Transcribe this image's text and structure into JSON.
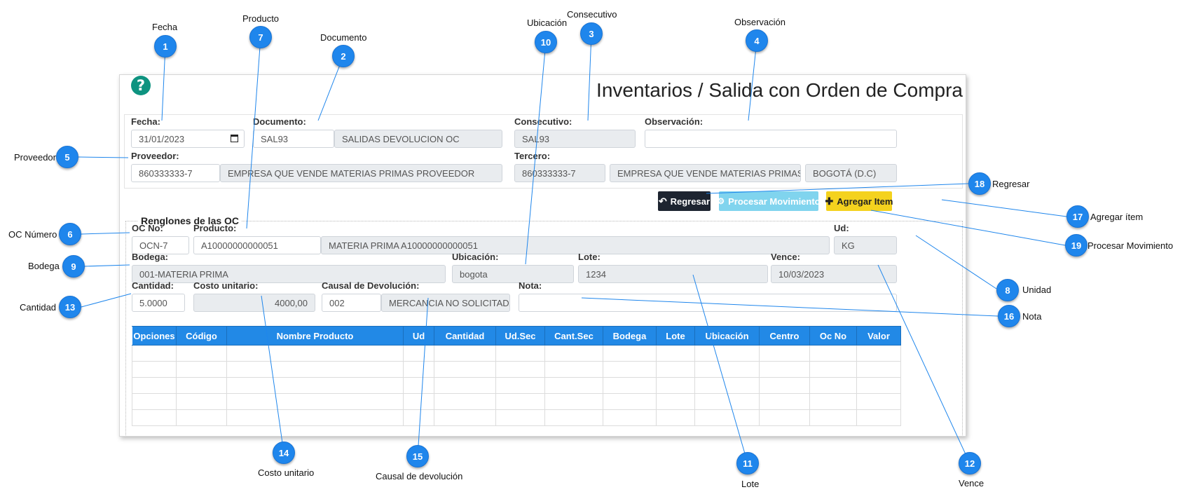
{
  "form": {
    "title": "Inventarios / Salida con Orden de Compra",
    "fecha_label": "Fecha:",
    "fecha_value": "31/01/2023",
    "documento_label": "Documento:",
    "documento_code": "SAL93",
    "documento_name": "SALIDAS DEVOLUCION OC",
    "consecutivo_label": "Consecutivo:",
    "consecutivo_value": "SAL93",
    "observacion_label": "Observación:",
    "observacion_value": "",
    "proveedor_label": "Proveedor:",
    "proveedor_nit": "860333333-7",
    "proveedor_name": "EMPRESA QUE VENDE MATERIAS PRIMAS PROVEEDOR",
    "tercero_label": "Tercero:",
    "tercero_nit": "860333333-7",
    "tercero_name": "EMPRESA QUE VENDE MATERIAS PRIMAS PRO",
    "tercero_city": "BOGOTÁ (D.C)"
  },
  "buttons": {
    "regresar": "Regresar",
    "procesar": "Procesar Movimiento",
    "agregar": "Agregar Item"
  },
  "renglones": {
    "legend": "Renglones de las OC",
    "oc_label": "OC No:",
    "oc_value": "OCN-7",
    "producto_label": "Producto:",
    "producto_code": "A10000000000051",
    "producto_name": "MATERIA PRIMA A10000000000051",
    "ud_label": "Ud:",
    "ud_value": "KG",
    "bodega_label": "Bodega:",
    "bodega_value": "001-MATERIA PRIMA",
    "ubicacion_label": "Ubicación:",
    "ubicacion_value": "bogota",
    "lote_label": "Lote:",
    "lote_value": "1234",
    "vence_label": "Vence:",
    "vence_value": "10/03/2023",
    "cantidad_label": "Cantidad:",
    "cantidad_value": "5.0000",
    "costo_label": "Costo unitario:",
    "costo_value": "4000,00",
    "causal_label": "Causal de Devolución:",
    "causal_code": "002",
    "causal_name": "MERCANCIA NO SOLICITADA.",
    "nota_label": "Nota:",
    "nota_value": ""
  },
  "table": {
    "columns": [
      "Opciones",
      "Código",
      "Nombre Producto",
      "Ud",
      "Cantidad",
      "Ud.Sec",
      "Cant.Sec",
      "Bodega",
      "Lote",
      "Ubicación",
      "Centro",
      "Oc No",
      "Valor"
    ],
    "rows": [
      [],
      [],
      [],
      [],
      []
    ]
  },
  "annotations": [
    {
      "num": "1",
      "label": "Fecha"
    },
    {
      "num": "2",
      "label": "Documento"
    },
    {
      "num": "3",
      "label": "Consecutivo"
    },
    {
      "num": "4",
      "label": "Observación"
    },
    {
      "num": "5",
      "label": "Proveedor"
    },
    {
      "num": "6",
      "label": "OC Número"
    },
    {
      "num": "7",
      "label": "Producto"
    },
    {
      "num": "8",
      "label": "Unidad"
    },
    {
      "num": "9",
      "label": "Bodega"
    },
    {
      "num": "10",
      "label": "Ubicación"
    },
    {
      "num": "11",
      "label": "Lote"
    },
    {
      "num": "12",
      "label": "Vence"
    },
    {
      "num": "13",
      "label": "Cantidad"
    },
    {
      "num": "14",
      "label": "Costo unitario"
    },
    {
      "num": "15",
      "label": "Causal de devolución"
    },
    {
      "num": "16",
      "label": "Nota"
    },
    {
      "num": "17",
      "label": "Agregar ítem"
    },
    {
      "num": "18",
      "label": "Regresar"
    },
    {
      "num": "19",
      "label": "Procesar Movimiento"
    }
  ],
  "colors": {
    "badge": "#1f86ec",
    "table_header": "#2289e6",
    "regresar_bg": "#1d2430",
    "procesar_bg": "#80d4ee",
    "agregar_bg": "#f4d21e",
    "help_icon": "#0e9380"
  }
}
